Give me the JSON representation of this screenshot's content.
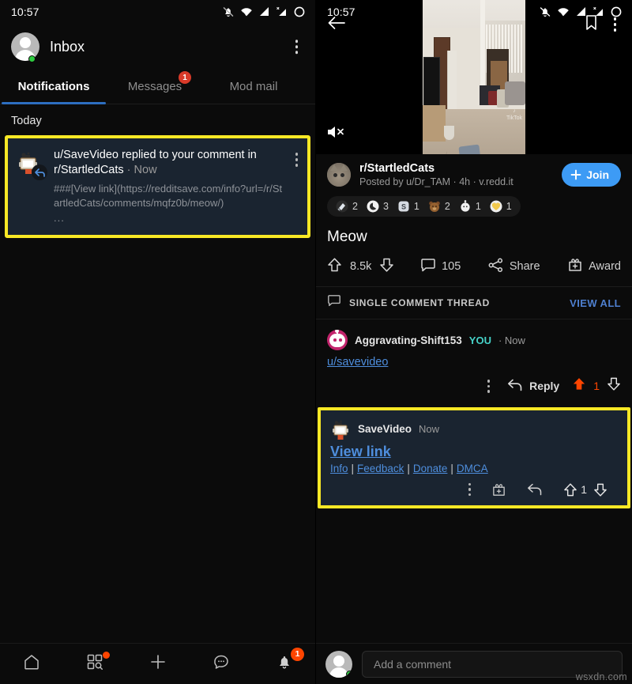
{
  "colors": {
    "highlight": "#f8e825",
    "highlight_bg": "#1a2430",
    "accent_blue": "#3d9bf5",
    "link_blue": "#4e8edd",
    "upvote_orange": "#ff4500",
    "badge_red": "#d93a29",
    "you_teal": "#46d2c8",
    "tab_underline": "#2d6ec0"
  },
  "status_bar": {
    "time": "10:57",
    "icons": [
      "bell-muted-icon",
      "wifi-icon",
      "signal-icon",
      "signal-no-sim-icon",
      "battery-circle-icon"
    ]
  },
  "left_pane": {
    "header": {
      "title": "Inbox",
      "avatar_name": "user-avatar",
      "overflow_label": "more-options"
    },
    "tabs": [
      {
        "label": "Notifications",
        "active": true,
        "badge": ""
      },
      {
        "label": "Messages",
        "active": false,
        "badge": "1"
      },
      {
        "label": "Mod mail",
        "active": false,
        "badge": ""
      }
    ],
    "section_label": "Today",
    "notification": {
      "title_main": "u/SaveVideo replied to your comment in r/StartledCats",
      "title_meta": " · Now",
      "snippet": "###[View link](https://redditsave.com/info?url=/r/StartledCats/comments/mqfz0b/meow/)",
      "ellipsis": "...",
      "avatar_name": "savevideo-avatar",
      "badge_icon": "reply-arrow-icon"
    },
    "bottom_nav": [
      {
        "name": "home",
        "icon": "home-icon",
        "badge": ""
      },
      {
        "name": "discover",
        "icon": "grid-search-icon",
        "dot": true,
        "badge": ""
      },
      {
        "name": "create",
        "icon": "plus-icon",
        "badge": ""
      },
      {
        "name": "chat",
        "icon": "chat-bubble-icon",
        "badge": ""
      },
      {
        "name": "notifications",
        "icon": "bell-icon",
        "badge": "1"
      }
    ]
  },
  "right_pane": {
    "top_bar": {
      "back_icon": "back-arrow-icon",
      "save_icon": "bookmark-icon",
      "overflow_icon": "more-options-icon",
      "mute_icon": "volume-muted-icon"
    },
    "post": {
      "subreddit": "r/StartledCats",
      "meta": "Posted by u/Dr_TAM · 4h · v.redd.it",
      "join_label": "Join",
      "title": "Meow",
      "awards": [
        {
          "name": "silver-award",
          "count": "2",
          "color": "#cfd6dd"
        },
        {
          "name": "helpful-award",
          "count": "3",
          "color": "#eaeaea"
        },
        {
          "name": "silver-s-award",
          "count": "1",
          "color": "#d3d8de"
        },
        {
          "name": "bear-award",
          "count": "2",
          "color": "#8a5a33"
        },
        {
          "name": "wholesome-award",
          "count": "1",
          "color": "#e8e8e8"
        },
        {
          "name": "gold-heart-award",
          "count": "1",
          "color": "#f2c94c"
        }
      ],
      "actions": {
        "upvote_icon": "upvote-arrow-icon",
        "score": "8.5k",
        "downvote_icon": "downvote-arrow-icon",
        "comments_icon": "comment-bubble-icon",
        "comments_count": "105",
        "share_icon": "share-icon",
        "share_label": "Share",
        "award_icon": "award-gift-icon",
        "award_label": "Award"
      }
    },
    "thread_bar": {
      "icon": "comment-bubble-icon",
      "label": "SINGLE COMMENT THREAD",
      "view_all": "VIEW ALL"
    },
    "user_comment": {
      "author": "Aggravating-Shift153",
      "you_badge": "YOU",
      "time": "· Now",
      "body_link": "u/savevideo",
      "actions": {
        "reply_label": "Reply",
        "vote_count": "1"
      }
    },
    "bot_comment": {
      "author": "SaveVideo",
      "time": "Now",
      "view_link": "View link",
      "links": [
        "Info",
        "Feedback",
        "Donate",
        "DMCA"
      ],
      "separator": "|",
      "actions": {
        "overflow_icon": "more-options-icon",
        "award_icon": "award-gift-icon",
        "reply_icon": "reply-arrow-icon",
        "upvote_icon": "upvote-arrow-icon",
        "vote_count": "1",
        "downvote_icon": "downvote-arrow-icon"
      }
    },
    "composer": {
      "avatar_name": "user-avatar",
      "placeholder": "Add a comment"
    },
    "watermark": "wsxdn.com"
  }
}
